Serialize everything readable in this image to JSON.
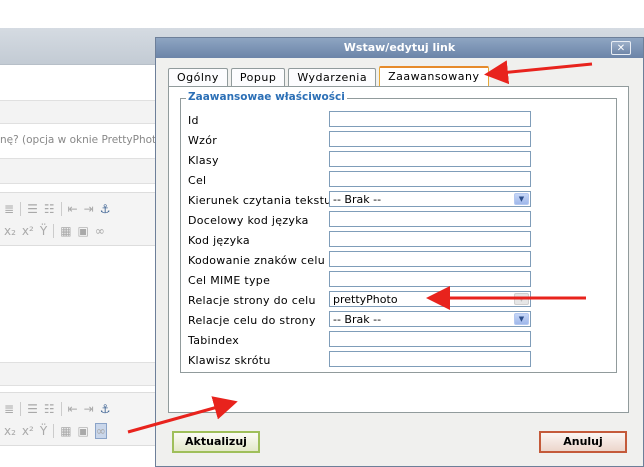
{
  "background": {
    "note_text": "nę?  (opcja w oknie PrettyPhoto)"
  },
  "dialog": {
    "title": "Wstaw/edytuj link",
    "close_symbol": "✕",
    "tabs": [
      {
        "label": "Ogólny",
        "active": false
      },
      {
        "label": "Popup",
        "active": false
      },
      {
        "label": "Wydarzenia",
        "active": false
      },
      {
        "label": "Zaawansowany",
        "active": true
      }
    ],
    "fieldset_legend": "Zaawansowae właściwości",
    "fields": {
      "id": {
        "label": "Id",
        "value": ""
      },
      "wzor": {
        "label": "Wzór",
        "value": ""
      },
      "klasy": {
        "label": "Klasy",
        "value": ""
      },
      "cel": {
        "label": "Cel",
        "value": ""
      },
      "kierunek": {
        "label": "Kierunek czytania tekstu",
        "value": "-- Brak --"
      },
      "docelowy_kod": {
        "label": "Docelowy kod języka",
        "value": ""
      },
      "kod_jezyka": {
        "label": "Kod języka",
        "value": ""
      },
      "kodowanie": {
        "label": "Kodowanie znaków celu",
        "value": ""
      },
      "mime": {
        "label": "Cel MIME type",
        "value": ""
      },
      "rel": {
        "label": "Relacje strony do celu",
        "value": "prettyPhoto"
      },
      "rev": {
        "label": "Relacje celu do strony",
        "value": "-- Brak --"
      },
      "tabindex": {
        "label": "Tabindex",
        "value": ""
      },
      "accesskey": {
        "label": "Klawisz skrótu",
        "value": ""
      }
    },
    "buttons": {
      "update": "Aktualizuj",
      "cancel": "Anuluj"
    }
  },
  "colors": {
    "annotation_arrow": "#e8231d",
    "legend": "#2b6fb6",
    "active_tab_border": "#e68b2c"
  }
}
